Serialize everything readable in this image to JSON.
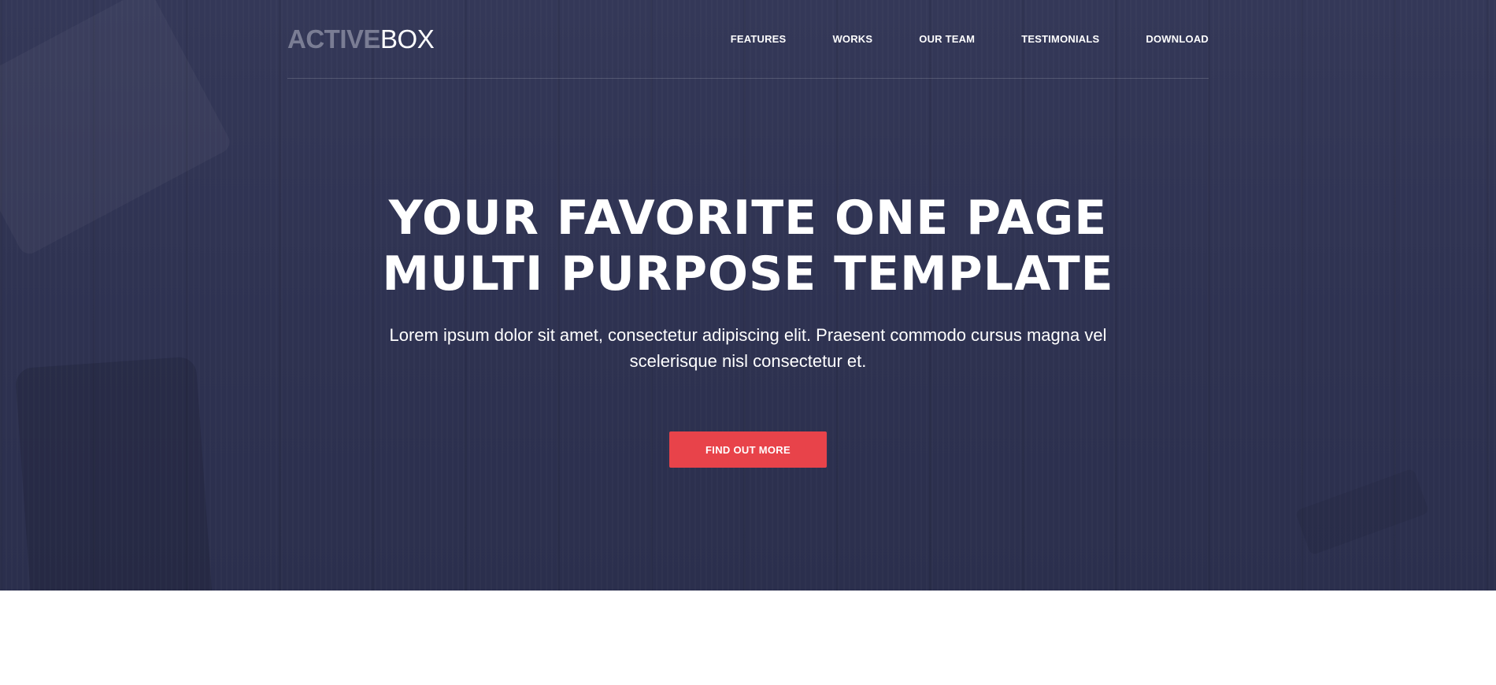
{
  "header": {
    "logo": {
      "part1": "ACTIVE",
      "part2": "BOX"
    },
    "nav": [
      {
        "label": "FEATURES"
      },
      {
        "label": "WORKS"
      },
      {
        "label": "OUR TEAM"
      },
      {
        "label": "TESTIMONIALS"
      },
      {
        "label": "DOWNLOAD"
      }
    ]
  },
  "hero": {
    "title_line1": "YOUR FAVORITE ONE PAGE",
    "title_line2": "MULTI PURPOSE TEMPLATE",
    "subtitle": "Lorem ipsum dolor sit amet, consectetur adipiscing elit. Praesent commodo cursus magna vel scelerisque nisl consectetur et.",
    "cta_label": "FIND OUT MORE"
  },
  "colors": {
    "hero_background": "#2f3352",
    "accent": "#e8434a",
    "logo_muted": "#7a7d94",
    "text": "#ffffff"
  }
}
